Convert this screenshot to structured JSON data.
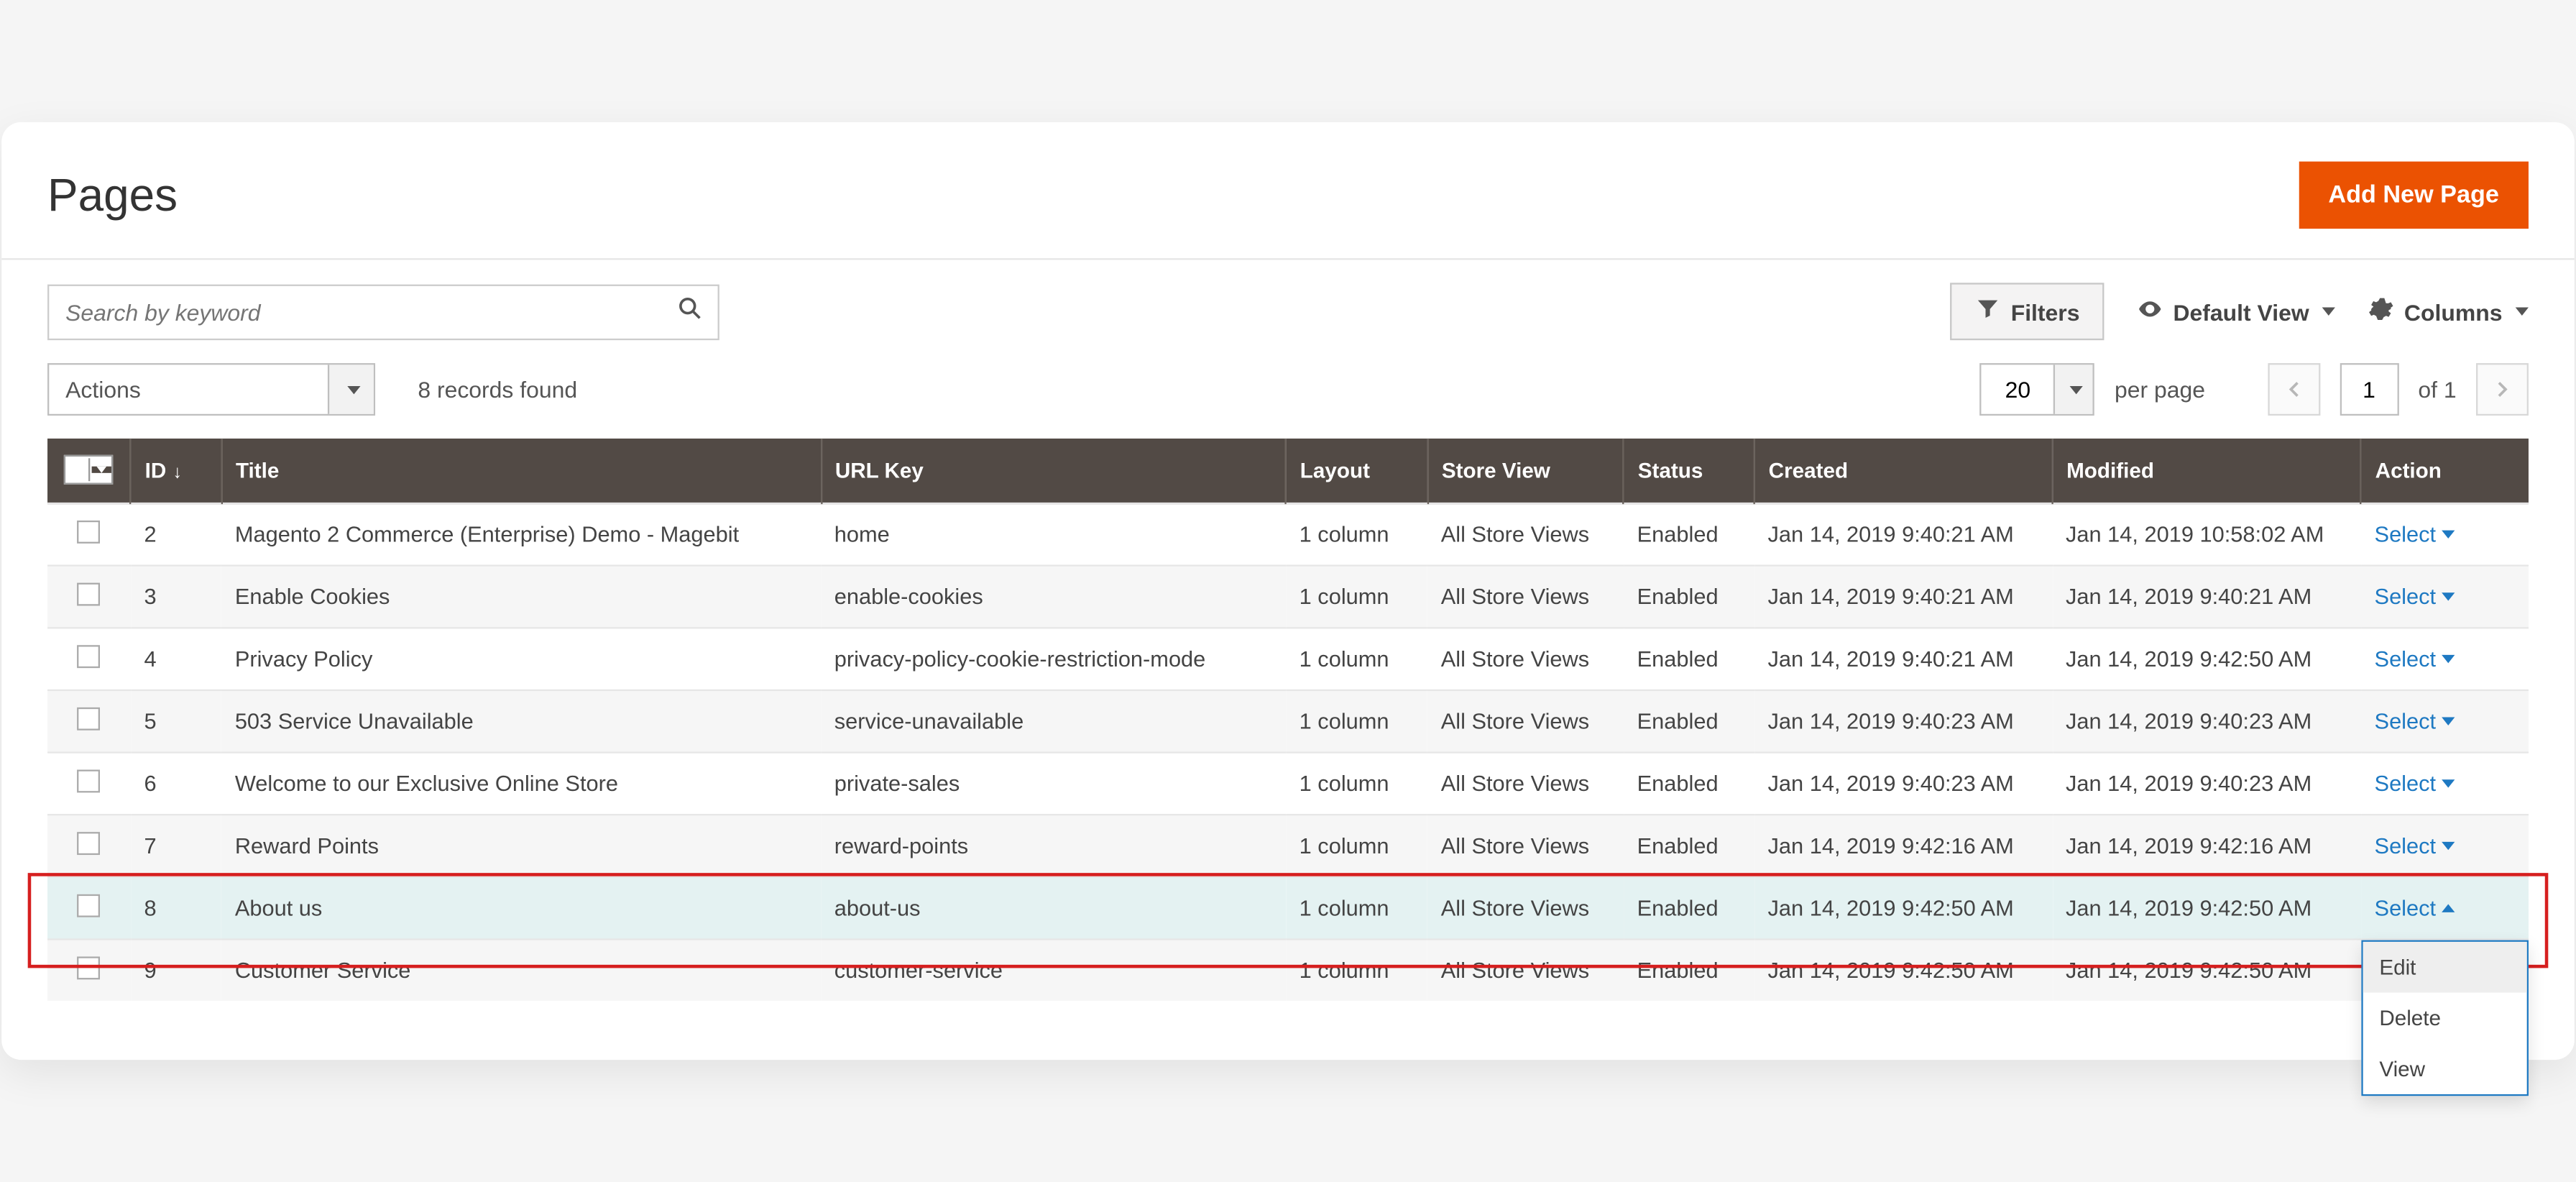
{
  "page": {
    "title": "Pages",
    "primary_action": "Add New Page"
  },
  "search": {
    "placeholder": "Search by keyword"
  },
  "toolbar": {
    "filters": "Filters",
    "default_view": "Default View",
    "columns": "Columns"
  },
  "actions": {
    "label": "Actions",
    "records": "8 records found"
  },
  "paging": {
    "size": "20",
    "per_page": "per page",
    "current": "1",
    "of_total": "of 1"
  },
  "columns": {
    "id": "ID",
    "title": "Title",
    "url_key": "URL Key",
    "layout": "Layout",
    "store_view": "Store View",
    "status": "Status",
    "created": "Created",
    "modified": "Modified",
    "action": "Action"
  },
  "rows": [
    {
      "id": "2",
      "title": "Magento 2 Commerce (Enterprise) Demo - Magebit",
      "url_key": "home",
      "layout": "1 column",
      "store_view": "All Store Views",
      "status": "Enabled",
      "created": "Jan 14, 2019 9:40:21 AM",
      "modified": "Jan 14, 2019 10:58:02 AM",
      "selected": false,
      "open": false
    },
    {
      "id": "3",
      "title": "Enable Cookies",
      "url_key": "enable-cookies",
      "layout": "1 column",
      "store_view": "All Store Views",
      "status": "Enabled",
      "created": "Jan 14, 2019 9:40:21 AM",
      "modified": "Jan 14, 2019 9:40:21 AM",
      "selected": false,
      "open": false
    },
    {
      "id": "4",
      "title": "Privacy Policy",
      "url_key": "privacy-policy-cookie-restriction-mode",
      "layout": "1 column",
      "store_view": "All Store Views",
      "status": "Enabled",
      "created": "Jan 14, 2019 9:40:21 AM",
      "modified": "Jan 14, 2019 9:42:50 AM",
      "selected": false,
      "open": false
    },
    {
      "id": "5",
      "title": "503 Service Unavailable",
      "url_key": "service-unavailable",
      "layout": "1 column",
      "store_view": "All Store Views",
      "status": "Enabled",
      "created": "Jan 14, 2019 9:40:23 AM",
      "modified": "Jan 14, 2019 9:40:23 AM",
      "selected": false,
      "open": false
    },
    {
      "id": "6",
      "title": "Welcome to our Exclusive Online Store",
      "url_key": "private-sales",
      "layout": "1 column",
      "store_view": "All Store Views",
      "status": "Enabled",
      "created": "Jan 14, 2019 9:40:23 AM",
      "modified": "Jan 14, 2019 9:40:23 AM",
      "selected": false,
      "open": false
    },
    {
      "id": "7",
      "title": "Reward Points",
      "url_key": "reward-points",
      "layout": "1 column",
      "store_view": "All Store Views",
      "status": "Enabled",
      "created": "Jan 14, 2019 9:42:16 AM",
      "modified": "Jan 14, 2019 9:42:16 AM",
      "selected": false,
      "open": false
    },
    {
      "id": "8",
      "title": "About us",
      "url_key": "about-us",
      "layout": "1 column",
      "store_view": "All Store Views",
      "status": "Enabled",
      "created": "Jan 14, 2019 9:42:50 AM",
      "modified": "Jan 14, 2019 9:42:50 AM",
      "selected": true,
      "open": true
    },
    {
      "id": "9",
      "title": "Customer Service",
      "url_key": "customer-service",
      "layout": "1 column",
      "store_view": "All Store Views",
      "status": "Enabled",
      "created": "Jan 14, 2019 9:42:50 AM",
      "modified": "Jan 14, 2019 9:42:50 AM",
      "selected": false,
      "open": false
    }
  ],
  "action_label": "Select",
  "action_menu": {
    "edit": "Edit",
    "delete": "Delete",
    "view": "View"
  },
  "highlighted_row_id": "8"
}
